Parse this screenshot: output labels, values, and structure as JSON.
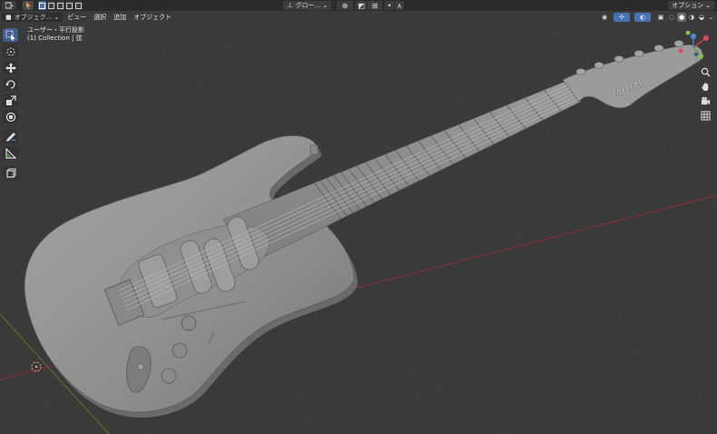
{
  "topbar": {
    "mode_label": "グロー...",
    "options_label": "オプション"
  },
  "header": {
    "mode_dropdown": "オブジェク...",
    "menus": [
      "ビュー",
      "選択",
      "追加",
      "オブジェクト"
    ]
  },
  "overlay": {
    "view_name": "ユーザー・平行投影",
    "collection": "(1) Collection | 弦"
  },
  "guitar": {
    "headstock_logo": "MOMI"
  },
  "tools": [
    "select-box",
    "cursor",
    "move",
    "rotate",
    "scale",
    "transform",
    "annotate",
    "measure",
    "add-cube"
  ],
  "nav_icons": [
    "zoom-icon",
    "pan-hand-icon",
    "camera-icon",
    "grid-view-icon"
  ],
  "colors": {
    "accent": "#4772b3",
    "background": "#3a3a3a",
    "grid_red": "#8a2d3a",
    "grid_green": "#5a7a2a"
  }
}
